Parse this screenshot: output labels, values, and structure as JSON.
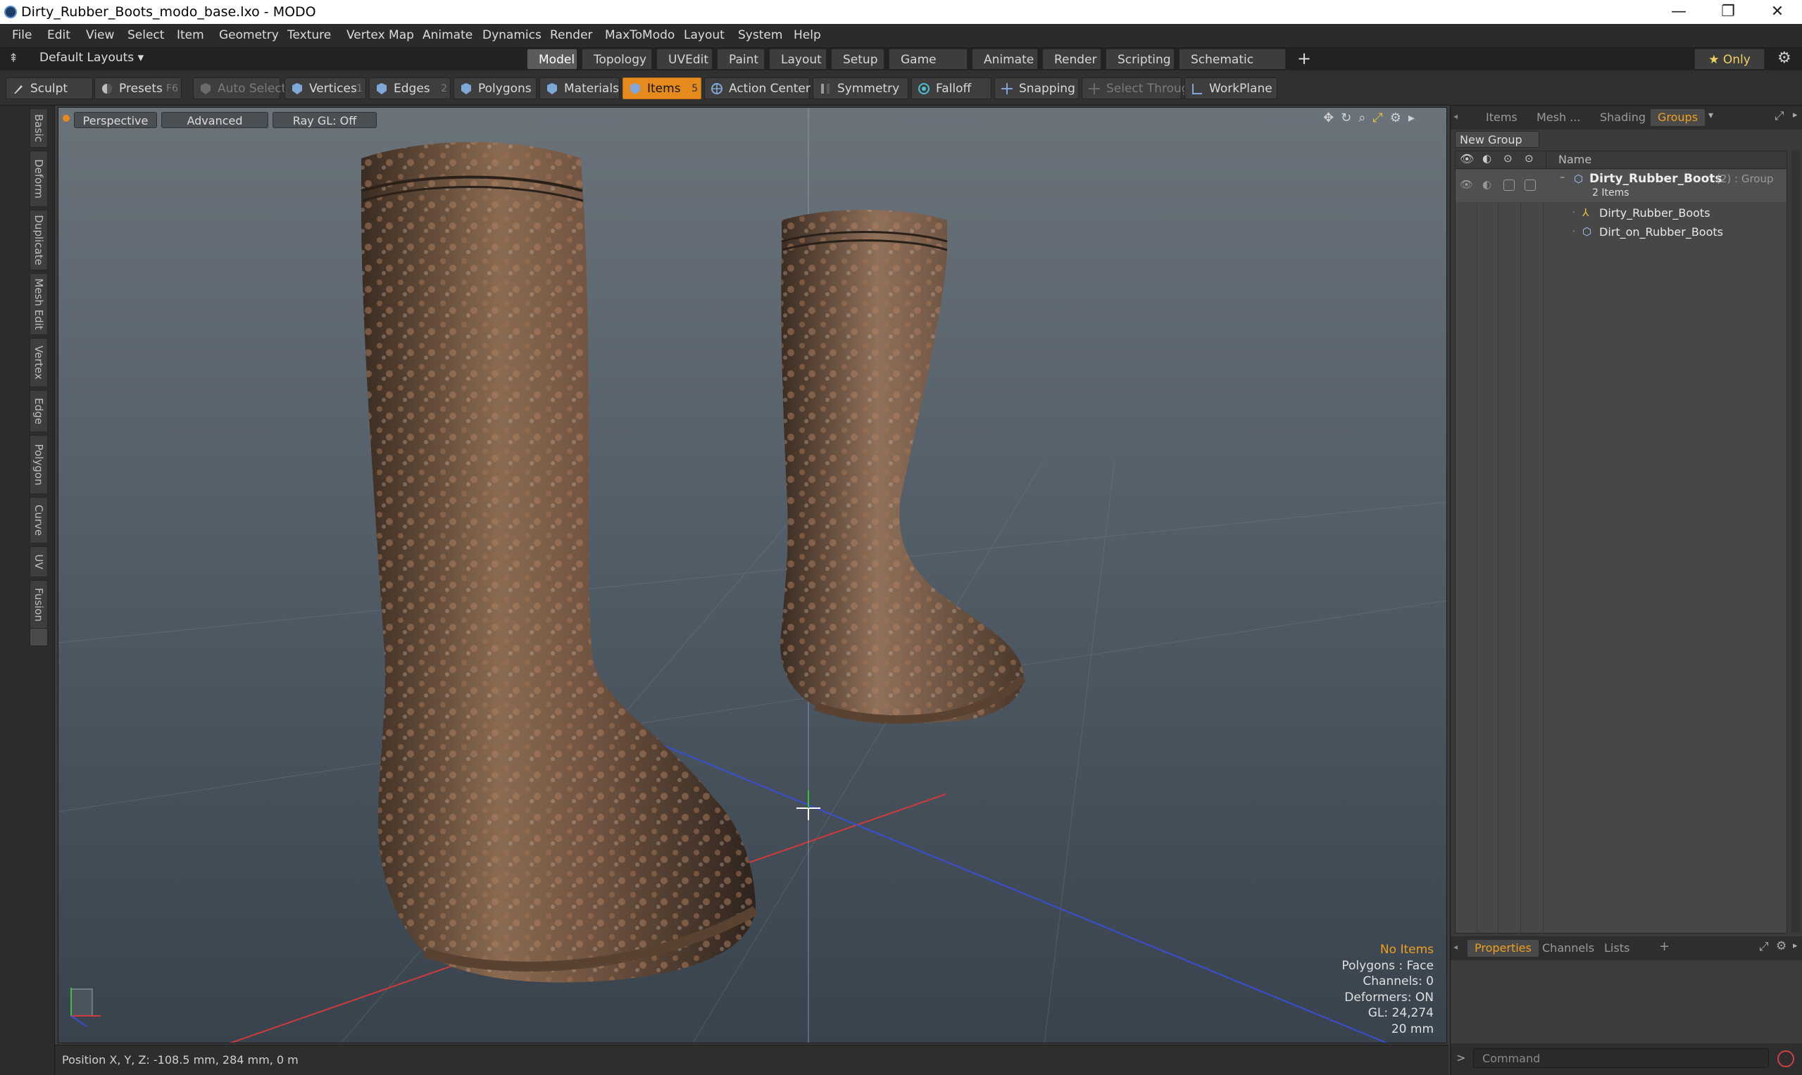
{
  "window": {
    "title": "Dirty_Rubber_Boots_modo_base.lxo - MODO",
    "minimize_glyph": "—",
    "maximize_glyph": "❐",
    "close_glyph": "✕"
  },
  "menu": [
    "File",
    "Edit",
    "View",
    "Select",
    "Item",
    "Geometry",
    "Texture",
    "Vertex Map",
    "Animate",
    "Dynamics",
    "Render",
    "MaxToModo",
    "Layout",
    "System",
    "Help"
  ],
  "layout_bar": {
    "layouts_label": "Default Layouts ▾",
    "tabs": [
      "Model",
      "Topology",
      "UVEdit",
      "Paint",
      "Layout",
      "Setup",
      "Game Tools",
      "Animate",
      "Render",
      "Scripting",
      "Schematic Fusion"
    ],
    "active_tab": "Model",
    "add_glyph": "+",
    "only_label": "★ Only"
  },
  "toolbar": {
    "sculpt": "Sculpt",
    "presets": "Presets",
    "presets_hotkey": "F6",
    "auto_select": "Auto Select",
    "vertices": "Vertices",
    "vertices_hotkey": "1",
    "edges": "Edges",
    "edges_hotkey": "2",
    "polygons": "Polygons",
    "materials": "Materials",
    "items": "Items",
    "items_hotkey": "5",
    "action_center": "Action Center",
    "symmetry": "Symmetry",
    "falloff": "Falloff",
    "snapping": "Snapping",
    "select_through": "Select Through",
    "workplane": "WorkPlane"
  },
  "left_tabs": [
    "Basic",
    "Deform",
    "Duplicate",
    "Mesh Edit",
    "Vertex",
    "Edge",
    "Polygon",
    "Curve",
    "UV",
    "Fusion"
  ],
  "viewport": {
    "view_mode": "Perspective",
    "shading": "Advanced",
    "raygl": "Ray GL: Off",
    "info": {
      "selection": "No Items",
      "polygons": "Polygons : Face",
      "channels": "Channels: 0",
      "deformers": "Deformers: ON",
      "gl": "GL: 24,274",
      "grid": "20 mm"
    }
  },
  "status": {
    "position": "Position X, Y, Z:  -108.5 mm, 284 mm, 0 m"
  },
  "right_panel": {
    "tabs": [
      "Items",
      "Mesh ...",
      "Shading",
      "Groups"
    ],
    "active_tab": "Groups",
    "new_group": "New Group",
    "column_name": "Name",
    "tree": {
      "group_name": "Dirty_Rubber_Boots",
      "group_suffix": "(2) : Group",
      "group_count": "2 Items",
      "children": [
        "Dirty_Rubber_Boots",
        "Dirt_on_Rubber_Boots"
      ]
    },
    "bottom_tabs": [
      "Properties",
      "Channels",
      "Lists"
    ],
    "bottom_active": "Properties",
    "add_tab_glyph": "+",
    "command_prompt": ">",
    "command_placeholder": "Command"
  },
  "colors": {
    "accent": "#e68a1e",
    "highlight_text": "#f0a020",
    "axis_x": "#d03a3a",
    "axis_y": "#3fbf3f",
    "axis_z": "#3a4fd0"
  }
}
